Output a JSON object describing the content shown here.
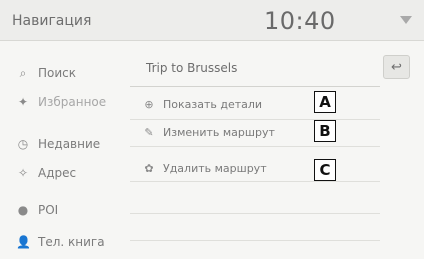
{
  "header": {
    "title": "Навигация",
    "time": "10:40",
    "status_icon": "signal-triangle-icon"
  },
  "sidebar": {
    "items": [
      {
        "label": "Поиск",
        "icon": "search-icon",
        "muted": false
      },
      {
        "label": "Избранное",
        "icon": "star-icon",
        "muted": true
      },
      {
        "label": "Недавние",
        "icon": "clock-icon",
        "muted": false
      },
      {
        "label": "Адрес",
        "icon": "address-icon",
        "muted": false
      },
      {
        "label": "POI",
        "icon": "pin-icon",
        "muted": false
      },
      {
        "label": "Тел. книга",
        "icon": "person-icon",
        "muted": false
      }
    ]
  },
  "route": {
    "title": "Trip to Brussels",
    "back_icon": "back-arrow-icon"
  },
  "menu": [
    {
      "label": "Показать детали",
      "icon": "info-icon",
      "callout": "A"
    },
    {
      "label": "Изменить маршрут",
      "icon": "pencil-icon",
      "callout": "B"
    },
    {
      "label": "Удалить маршрут",
      "icon": "trash-icon",
      "callout": "C"
    }
  ],
  "colors": {
    "background": "#f6f6f4",
    "header": "#ededeb",
    "text": "#7a7a7a",
    "callout_border": "#111111"
  }
}
